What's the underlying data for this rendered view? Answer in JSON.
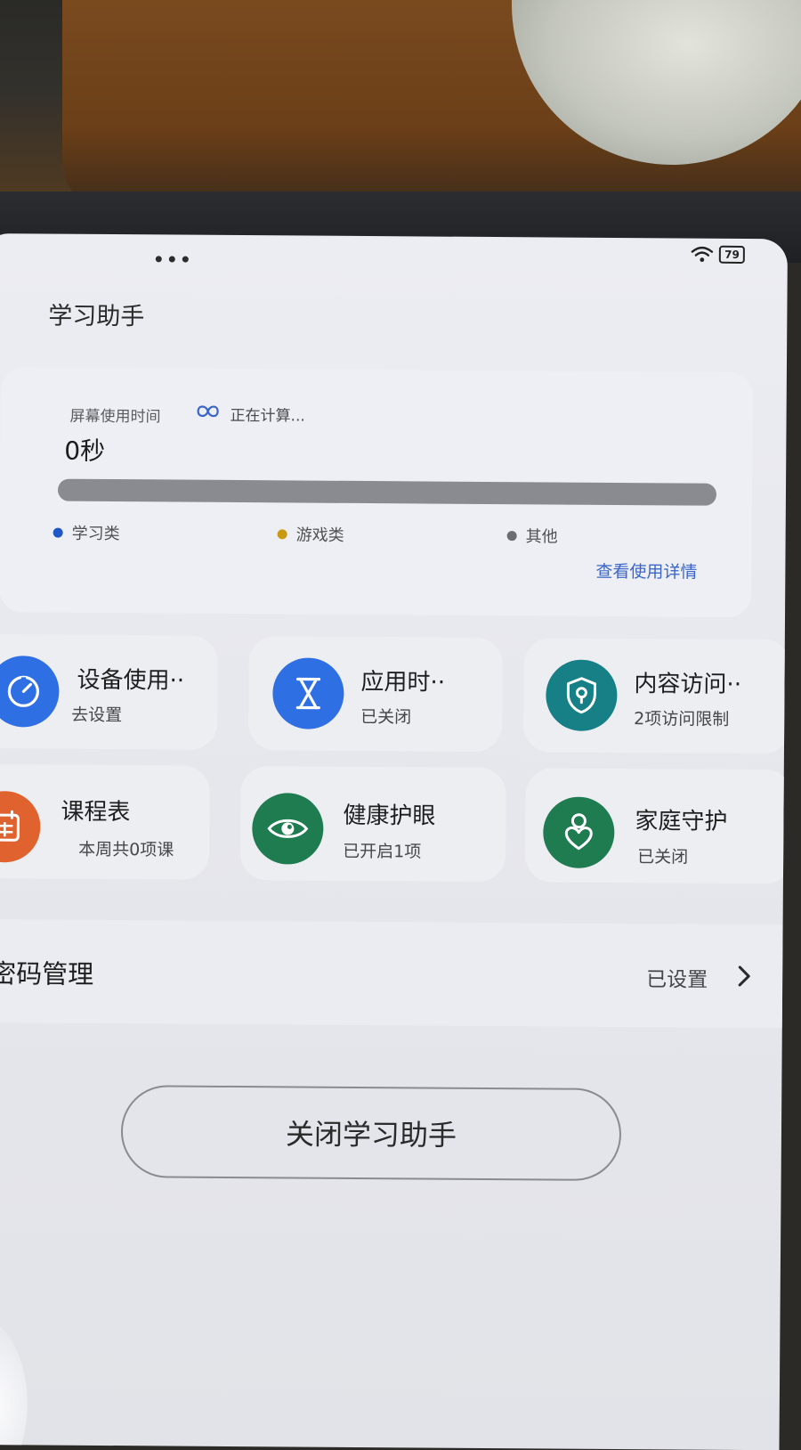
{
  "status_bar": {
    "battery": "79"
  },
  "page": {
    "title": "学习助手"
  },
  "screen_time": {
    "label": "屏幕使用时间",
    "status": "正在计算...",
    "value": "0秒",
    "legend": [
      {
        "label": "学习类",
        "color": "#1f57c7"
      },
      {
        "label": "游戏类",
        "color": "#c99a10"
      },
      {
        "label": "其他",
        "color": "#6b6c70"
      }
    ],
    "view_detail_link": "查看使用详情"
  },
  "tiles": [
    {
      "title": "设备使用··",
      "subtitle": "去设置",
      "icon": "timer-icon",
      "color": "#2f6fe4"
    },
    {
      "title": "应用时··",
      "subtitle": "已关闭",
      "icon": "hourglass-icon",
      "color": "#2f6fe4"
    },
    {
      "title": "内容访问··",
      "subtitle": "2项访问限制",
      "icon": "shield-lock-icon",
      "color": "#177f86"
    },
    {
      "title": "课程表",
      "subtitle": "本周共0项课",
      "icon": "calendar-icon",
      "color": "#e0622e"
    },
    {
      "title": "健康护眼",
      "subtitle": "已开启1项",
      "icon": "eye-icon",
      "color": "#1f7c51"
    },
    {
      "title": "家庭守护",
      "subtitle": "已关闭",
      "icon": "family-heart-icon",
      "color": "#1f7c51"
    }
  ],
  "password": {
    "label": "密码管理",
    "value": "已设置"
  },
  "close_button": {
    "label": "关闭学习助手"
  }
}
